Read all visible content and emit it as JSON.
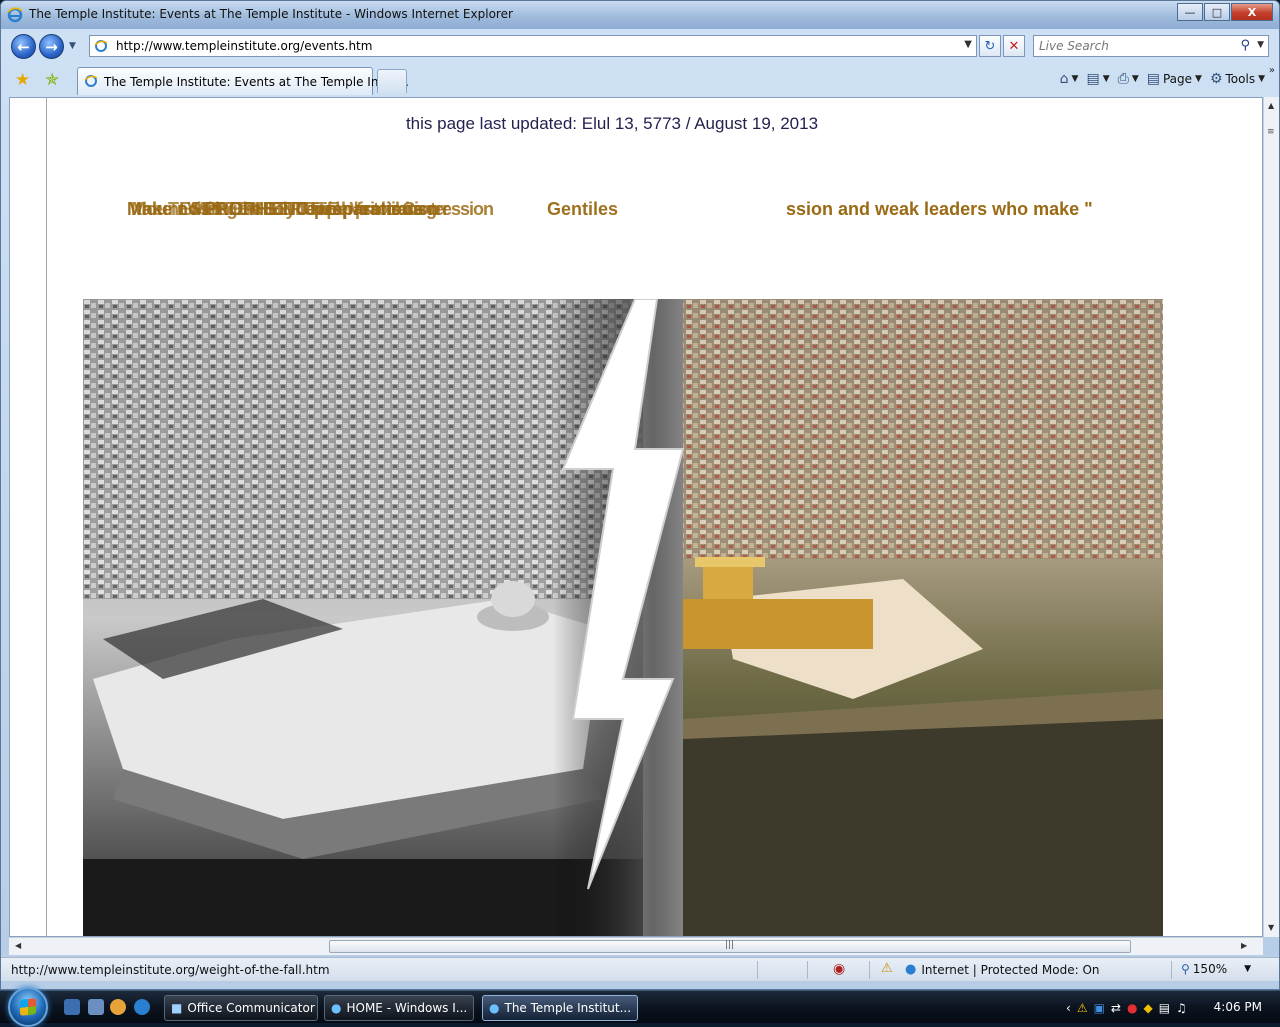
{
  "window": {
    "title": "The Temple Institute: Events at The Temple Institute - Windows Internet Explorer",
    "minimize": "—",
    "maximize": "□",
    "close": "X"
  },
  "address_bar": {
    "url": "http://www.templeinstitute.org/events.htm",
    "search_placeholder": "Live Search"
  },
  "tabs": [
    {
      "label": "The Temple Institute: Events at The Temple Instit..."
    }
  ],
  "commands": {
    "page_label": "Page",
    "tools_label": "Tools"
  },
  "page": {
    "last_updated": "this page last updated: Elul 13, 5773 / August 19, 2013",
    "ticker_visible_text": "ssion and weak leaders who make \"",
    "ticker_overlap_layers": [
      "Make no PROPHETIC preparations",
      "Mount SEPTEMBER Temple",
      "the TEMPLE INSTITUTE",
      "Visiting the Holy Temple Visitors Center",
      "Jewish prohibition",
      "transgression",
      "Gentiles"
    ],
    "banner_alt": "Temple Mount then and now"
  },
  "status_bar": {
    "link": "http://www.templeinstitute.org/weight-of-the-fall.htm",
    "zone": "Internet | Protected Mode: On",
    "zoom": "150%"
  },
  "taskbar": {
    "buttons": [
      {
        "label": "Office Communicator"
      },
      {
        "label": "HOME - Windows I..."
      },
      {
        "label": "The Temple Institut..."
      }
    ],
    "time": "4:06 PM"
  },
  "colors": {
    "ticker": "#9a6a14",
    "updated_text": "#222250",
    "taskbar": "#0c1420"
  }
}
